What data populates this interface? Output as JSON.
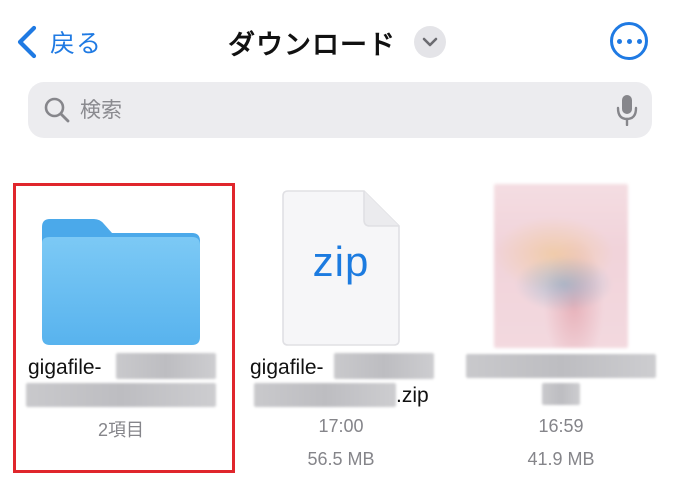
{
  "nav": {
    "back_label": "戻る",
    "title": "ダウンロード"
  },
  "search": {
    "placeholder": "検索",
    "value": ""
  },
  "items": [
    {
      "type": "folder",
      "name_prefix": "gigafile-",
      "count_label": "2項目",
      "selected": true
    },
    {
      "type": "zip",
      "icon_text": "zip",
      "name_prefix": "gigafile-",
      "name_suffix": ".zip",
      "time": "17:00",
      "size": "56.5 MB"
    },
    {
      "type": "image",
      "time": "16:59",
      "size": "41.9 MB"
    }
  ],
  "colors": {
    "accent": "#1f7ae3",
    "selection": "#e0262c",
    "folder": "#5fb9f0",
    "secondary_text": "#85858a"
  },
  "icons": [
    "chevron-left-icon",
    "chevron-down-icon",
    "more-icon",
    "search-icon",
    "microphone-icon",
    "folder-icon",
    "zip-file-icon"
  ]
}
